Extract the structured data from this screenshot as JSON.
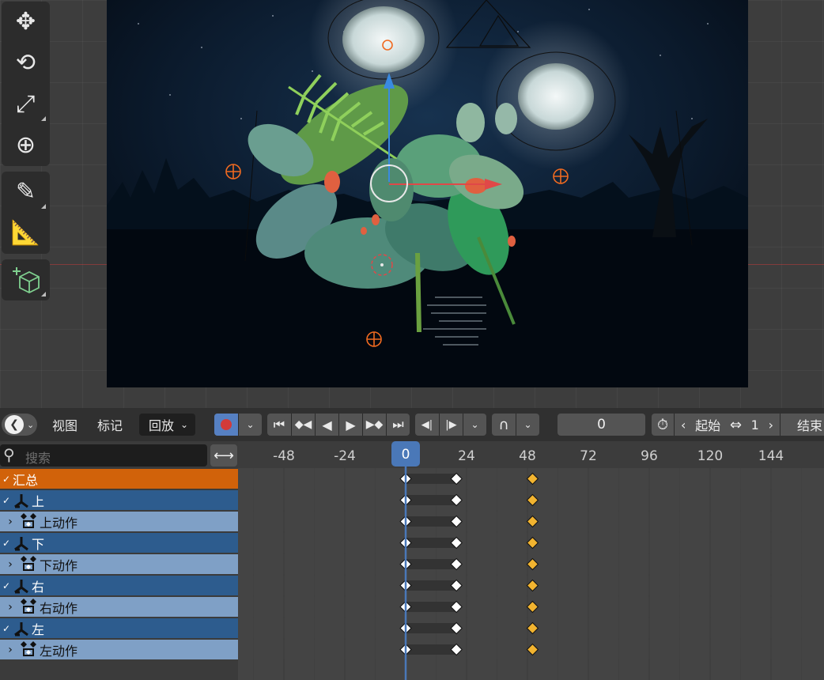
{
  "header": {
    "editor_type_icon": "dope-sheet-icon",
    "menu": {
      "view": "视图",
      "marker": "标记",
      "playback": "回放"
    },
    "record_icon": "record-icon",
    "transport_icons": [
      "jump-start-icon",
      "prev-keyframe-icon",
      "play-reverse-icon",
      "play-icon",
      "next-keyframe-icon",
      "jump-end-icon"
    ],
    "frame_step_icons": [
      "step-back-icon",
      "step-forward-icon"
    ],
    "snap_icon": "magnet-icon",
    "current_frame": "0",
    "stopwatch_icon": "stopwatch-icon",
    "start_label": "起始",
    "start_value": "1",
    "end_label": "结束"
  },
  "toolbar": {
    "icons": [
      "move-icon",
      "rotate-icon",
      "scale-icon",
      "transform-icon",
      "annotate-icon",
      "measure-icon",
      "add-cube-icon"
    ]
  },
  "channels": {
    "search_placeholder": "搜索",
    "swap_icon": "swap-arrows-icon",
    "rows": [
      {
        "type": "summary",
        "label": "汇总"
      },
      {
        "type": "object",
        "label": "上"
      },
      {
        "type": "action",
        "label": "上动作"
      },
      {
        "type": "object",
        "label": "下"
      },
      {
        "type": "action",
        "label": "下动作"
      },
      {
        "type": "object",
        "label": "右"
      },
      {
        "type": "action",
        "label": "右动作"
      },
      {
        "type": "object",
        "label": "左"
      },
      {
        "type": "action",
        "label": "左动作"
      }
    ]
  },
  "timeline": {
    "ruler_labels": [
      "-48",
      "-24",
      "0",
      "24",
      "48",
      "72",
      "96",
      "120",
      "144"
    ],
    "ruler_frames": [
      -48,
      -24,
      0,
      24,
      48,
      72,
      96,
      120,
      144
    ],
    "current_frame": 0,
    "keyframes": [
      {
        "frame": 0,
        "kind": "white"
      },
      {
        "frame": 20,
        "kind": "white"
      },
      {
        "frame": 50,
        "kind": "yellow"
      }
    ],
    "hold_from": 0,
    "hold_to": 20
  },
  "colors": {
    "summary_row": "#d1620a",
    "object_row": "#2d5c8e",
    "action_row": "#7fa0c6",
    "playhead": "#4a78b8",
    "key_selected": "#f2b430",
    "key_normal": "#ffffff"
  }
}
